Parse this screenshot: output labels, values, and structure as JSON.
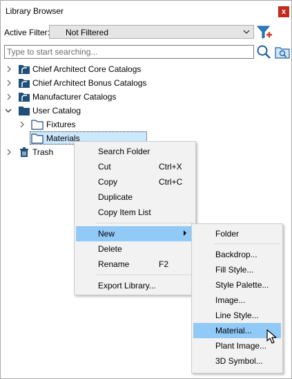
{
  "window": {
    "title": "Library Browser",
    "close_label": "x"
  },
  "filter": {
    "label": "Active Filter:",
    "value": "Not Filtered"
  },
  "search": {
    "placeholder": "Type to start searching..."
  },
  "tree": {
    "items": [
      {
        "label": "Chief Architect Core Catalogs",
        "expanded": false,
        "icon": "catalog-icon"
      },
      {
        "label": "Chief Architect Bonus Catalogs",
        "expanded": false,
        "icon": "catalog-icon"
      },
      {
        "label": "Manufacturer Catalogs",
        "expanded": false,
        "icon": "catalog-icon"
      },
      {
        "label": "User Catalog",
        "expanded": true,
        "icon": "folder-icon",
        "children": [
          {
            "label": "Fixtures",
            "icon": "folder-outline-icon"
          },
          {
            "label": "Materials",
            "icon": "folder-outline-icon",
            "selected": true
          }
        ]
      },
      {
        "label": "Trash",
        "expanded": false,
        "icon": "trash-icon"
      }
    ]
  },
  "context_menu": {
    "items": [
      {
        "label": "Search Folder",
        "shortcut": ""
      },
      {
        "label": "Cut",
        "shortcut": "Ctrl+X"
      },
      {
        "label": "Copy",
        "shortcut": "Ctrl+C"
      },
      {
        "label": "Duplicate",
        "shortcut": ""
      },
      {
        "label": "Copy Item List",
        "shortcut": ""
      },
      {
        "label": "New",
        "shortcut": "",
        "submenu": true,
        "highlighted": true
      },
      {
        "label": "Delete",
        "shortcut": ""
      },
      {
        "label": "Rename",
        "shortcut": "F2"
      },
      {
        "label": "Export Library...",
        "shortcut": ""
      }
    ]
  },
  "submenu": {
    "items": [
      {
        "label": "Folder"
      },
      {
        "label": "Backdrop..."
      },
      {
        "label": "Fill Style..."
      },
      {
        "label": "Style Palette..."
      },
      {
        "label": "Image..."
      },
      {
        "label": "Line Style..."
      },
      {
        "label": "Material...",
        "highlighted": true
      },
      {
        "label": "Plant Image..."
      },
      {
        "label": "3D Symbol..."
      }
    ]
  },
  "colors": {
    "catalog_icon": "#1f4e79",
    "menu_highlight": "#91c9f7",
    "selection_bg": "#cce8ff",
    "close_button": "#c42b1c"
  }
}
